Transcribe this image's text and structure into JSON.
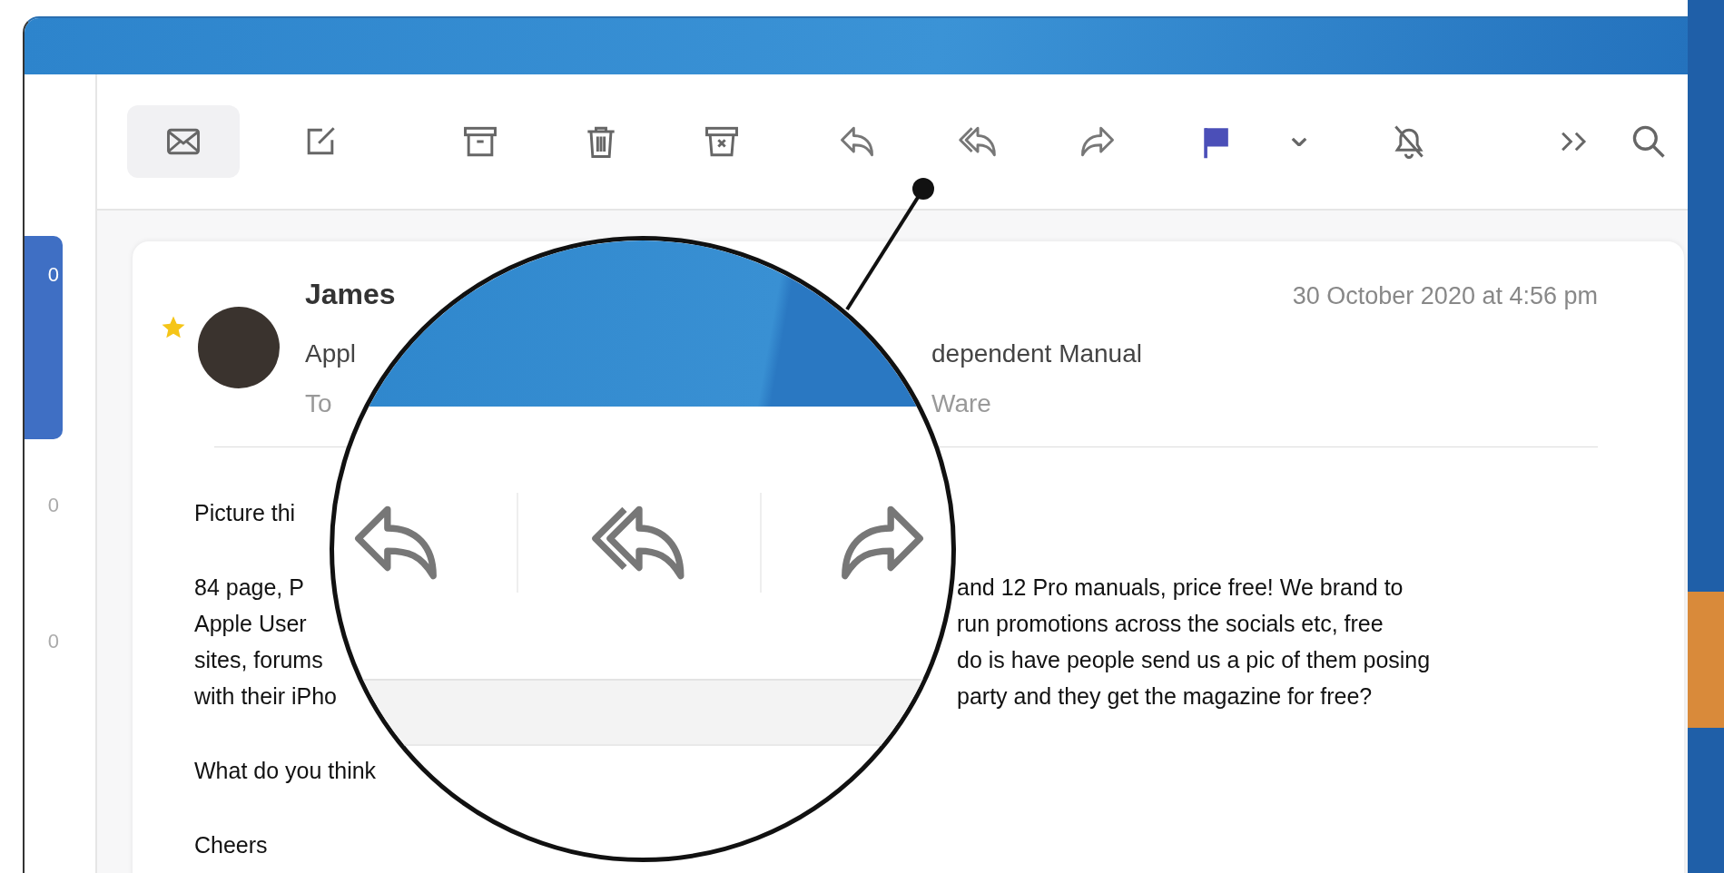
{
  "sidebar": {
    "items": [
      {
        "count": "0",
        "selected": true
      },
      {
        "count": "0",
        "selected": false
      },
      {
        "count": "0",
        "selected": false
      }
    ]
  },
  "toolbar": {
    "buttons": [
      {
        "kind": "mail",
        "selected": true
      },
      {
        "kind": "compose",
        "selected": false
      },
      {
        "kind": "archive",
        "selected": false
      },
      {
        "kind": "trash",
        "selected": false
      },
      {
        "kind": "junk",
        "selected": false
      },
      {
        "kind": "reply",
        "selected": false
      },
      {
        "kind": "reply_all",
        "selected": false
      },
      {
        "kind": "forward",
        "selected": false
      },
      {
        "kind": "flag",
        "selected": false
      },
      {
        "kind": "chevron",
        "selected": false
      },
      {
        "kind": "mute",
        "selected": false
      },
      {
        "kind": "more",
        "selected": false
      },
      {
        "kind": "search",
        "selected": false
      }
    ]
  },
  "message": {
    "starred": true,
    "sender": "James",
    "date": "30 October 2020 at 4:56 pm",
    "header_lines": [
      {
        "kind": "subject",
        "start": "Appl",
        "end": "dependent Manual"
      },
      {
        "kind": "to",
        "start": "To",
        "end": "Ware"
      }
    ],
    "paragraphs": [
      {
        "lines": [
          {
            "start": "Picture thi"
          }
        ]
      },
      {
        "lines": [
          {
            "start": "84 page, P",
            "end": "and 12 Pro manuals, price free! We brand to"
          },
          {
            "start": "Apple User",
            "end": "run promotions across the socials etc, free"
          },
          {
            "start": "sites, forums",
            "end": "do is have people send us a pic of them posing"
          },
          {
            "start": "with their iPho",
            "end": "party and they get the magazine for free?"
          }
        ]
      },
      {
        "lines": [
          {
            "start": "What do you think"
          }
        ]
      },
      {
        "lines": [
          {
            "start": "Cheers"
          }
        ]
      }
    ]
  },
  "magnifier": {
    "buttons": [
      {
        "kind": "reply"
      },
      {
        "kind": "reply_all"
      },
      {
        "kind": "forward"
      }
    ]
  }
}
